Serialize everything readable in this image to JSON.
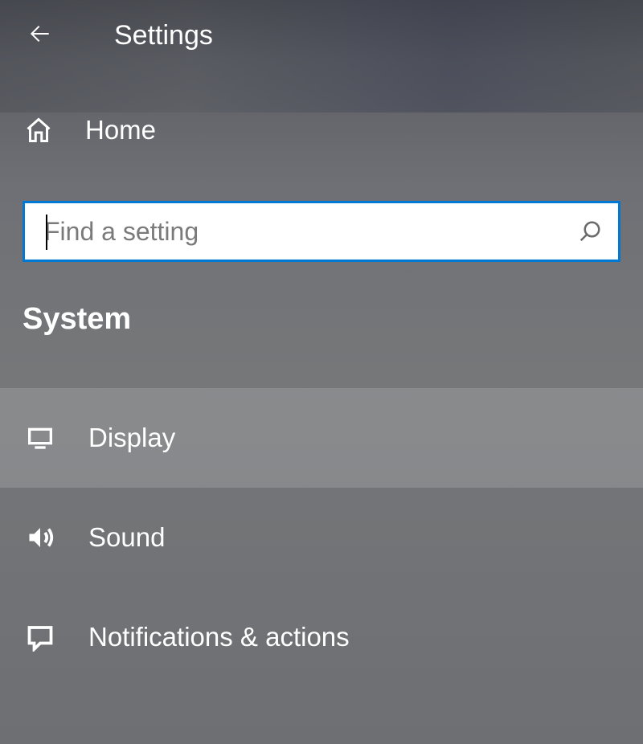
{
  "header": {
    "title": "Settings"
  },
  "nav": {
    "home_label": "Home"
  },
  "search": {
    "placeholder": "Find a setting",
    "value": ""
  },
  "section": {
    "title": "System"
  },
  "menu": {
    "items": [
      {
        "id": "display",
        "label": "Display",
        "selected": true
      },
      {
        "id": "sound",
        "label": "Sound",
        "selected": false
      },
      {
        "id": "notifications",
        "label": "Notifications & actions",
        "selected": false
      }
    ]
  },
  "colors": {
    "accent": "#0078d4",
    "text": "#ffffff"
  }
}
